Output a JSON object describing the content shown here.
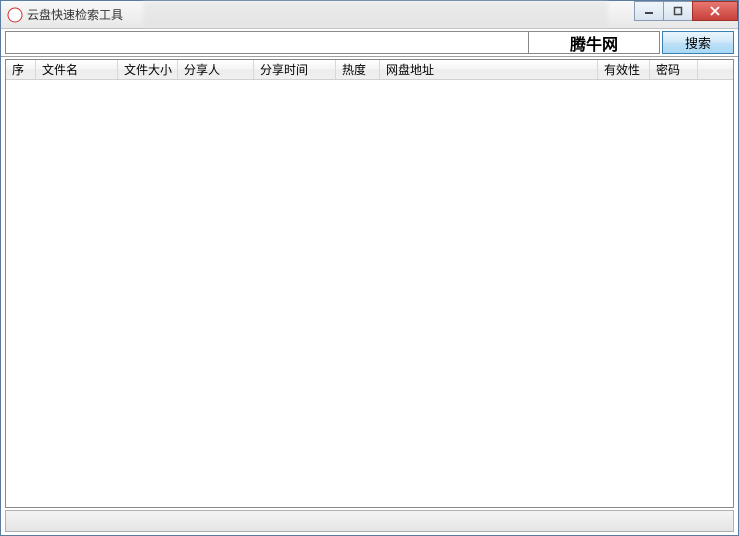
{
  "window": {
    "title": "云盘快速检索工具"
  },
  "toolbar": {
    "search_value": "",
    "brand": "腾牛网",
    "search_button": "搜索"
  },
  "table": {
    "columns": {
      "index": "序",
      "filename": "文件名",
      "filesize": "文件大小",
      "sharer": "分享人",
      "sharetime": "分享时间",
      "heat": "热度",
      "diskurl": "网盘地址",
      "validity": "有效性",
      "password": "密码"
    }
  },
  "statusbar": {
    "text": ""
  }
}
